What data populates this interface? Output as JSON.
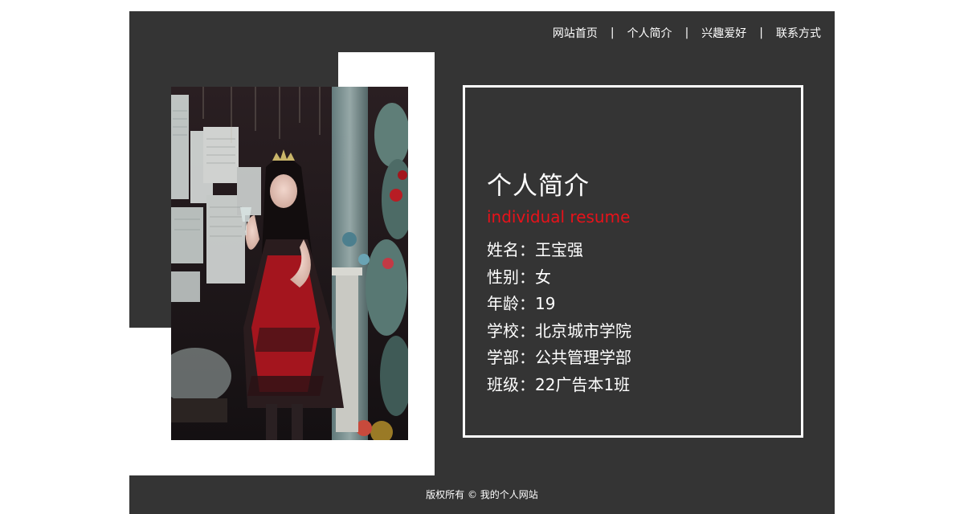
{
  "nav": {
    "items": [
      {
        "label": "网站首页"
      },
      {
        "label": "个人简介"
      },
      {
        "label": "兴趣爱好"
      },
      {
        "label": "联系方式"
      }
    ],
    "separator": "|"
  },
  "resume": {
    "title": "个人简介",
    "subtitle": "individual resume",
    "rows": [
      {
        "text": "姓名：王宝强"
      },
      {
        "text": "性别：女"
      },
      {
        "text": "年龄：19"
      },
      {
        "text": "学校：北京城市学院"
      },
      {
        "text": "学部：公共管理学部"
      },
      {
        "text": "班级：22广告本1班"
      }
    ]
  },
  "footer": {
    "text": "版权所有 © 我的个人网站"
  },
  "colors": {
    "background_dark": "#343434",
    "accent_red": "#e8121a",
    "text_white": "#ffffff"
  }
}
